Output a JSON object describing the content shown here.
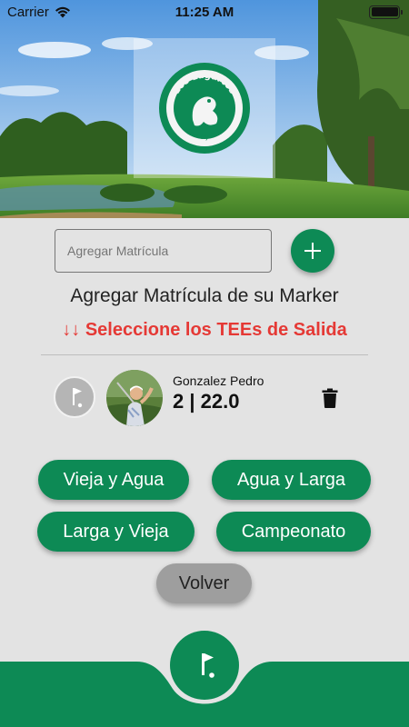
{
  "status_bar": {
    "carrier": "Carrier",
    "time": "11:25 AM",
    "battery_level": 1.0,
    "icons": [
      "wifi-icon",
      "battery-icon"
    ]
  },
  "hero": {
    "logo_text_top": "Los Lagartos",
    "logo_text_bottom": "Country Club"
  },
  "matricula": {
    "placeholder": "Agregar Matrícula",
    "value": ""
  },
  "add_button": {
    "icon": "plus-icon"
  },
  "title": "Agregar Matrícula de su Marker",
  "warning": "↓↓ Seleccione los TEEs de Salida",
  "player": {
    "name": "Gonzalez Pedro",
    "score": "2 | 22.0",
    "icons": [
      "golf-flag-icon",
      "trash-icon"
    ]
  },
  "tees": [
    {
      "label": "Vieja y Agua"
    },
    {
      "label": "Agua y Larga"
    },
    {
      "label": "Larga y Vieja"
    },
    {
      "label": "Campeonato"
    }
  ],
  "volver_label": "Volver",
  "nav": {
    "center_icon": "golf-flag-icon"
  },
  "colors": {
    "primary": "#0d8a55",
    "warning": "#e53935",
    "background": "#e3e3e3",
    "secondary_button": "#9e9e9e"
  }
}
